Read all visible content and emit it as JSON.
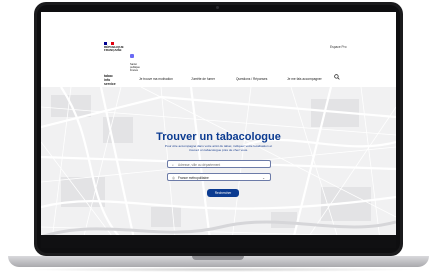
{
  "header": {
    "gov_logo_text": [
      "RÉPUBLIQUE",
      "FRANÇAISE"
    ],
    "partner_logo_text": [
      "Santé",
      "publique",
      "France"
    ],
    "login_label": "Espace Pro",
    "brand": [
      "tabac",
      "info",
      "service"
    ],
    "nav_items": [
      "Je trouve ma motivation",
      "J'arrête de fumer",
      "Questions / Réponses",
      "Je me fais accompagner"
    ]
  },
  "hero": {
    "title": "Trouver un tabacologue",
    "subtitle": "Pour être accompagné dans votre arrêt du tabac, indiquez votre localisation et trouvez un tabacologue près de chez vous.",
    "location_placeholder": "Adresse, ville ou département",
    "region_select_value": "France métropolitaine",
    "search_button": "Rechercher"
  },
  "colors": {
    "brand_blue": "#0b3b91",
    "map_background": "#f1f1f2",
    "laptop_frame": "#1b1b1d"
  },
  "icons": [
    "search-icon",
    "location-pin-icon",
    "chevron-down-icon",
    "camera-icon"
  ]
}
